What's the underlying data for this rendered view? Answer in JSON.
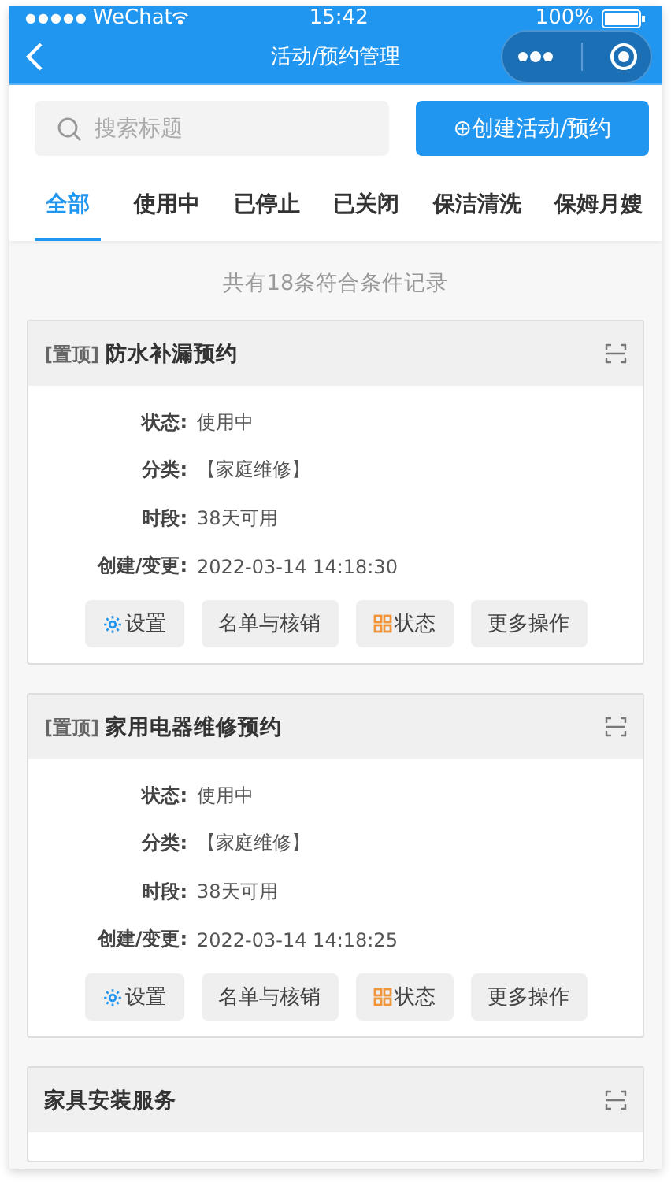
{
  "status_bar": {
    "signal": "●●●●●",
    "carrier": "WeChat",
    "time": "15:42",
    "battery": "100%"
  },
  "nav": {
    "title": "活动/预约管理"
  },
  "search": {
    "placeholder": "搜索标题"
  },
  "create_button": {
    "icon": "⊕",
    "label": "创建活动/预约"
  },
  "tabs": [
    {
      "label": "全部",
      "selected": true
    },
    {
      "label": "使用中",
      "selected": false
    },
    {
      "label": "已停止",
      "selected": false
    },
    {
      "label": "已关闭",
      "selected": false
    },
    {
      "label": "保洁清洗",
      "selected": false
    },
    {
      "label": "保姆月嫂",
      "selected": false
    }
  ],
  "count_text": "共有18条符合条件记录",
  "cards": [
    {
      "tag": "[置顶]",
      "title": "防水补漏预约",
      "fields": [
        {
          "label": "状态:",
          "value": "使用中"
        },
        {
          "label": "分类:",
          "value": "【家庭维修】"
        },
        {
          "label": "时段:",
          "value": "38天可用"
        },
        {
          "label": "创建/变更:",
          "value": "2022-03-14 14:18:30"
        }
      ],
      "actions": [
        {
          "kind": "gear",
          "label": "设置"
        },
        {
          "kind": "plain",
          "label": "名单与核销"
        },
        {
          "kind": "grid",
          "label": "状态"
        },
        {
          "kind": "plain",
          "label": "更多操作"
        }
      ]
    },
    {
      "tag": "[置顶]",
      "title": "家用电器维修预约",
      "fields": [
        {
          "label": "状态:",
          "value": "使用中"
        },
        {
          "label": "分类:",
          "value": "【家庭维修】"
        },
        {
          "label": "时段:",
          "value": "38天可用"
        },
        {
          "label": "创建/变更:",
          "value": "2022-03-14 14:18:25"
        }
      ],
      "actions": [
        {
          "kind": "gear",
          "label": "设置"
        },
        {
          "kind": "plain",
          "label": "名单与核销"
        },
        {
          "kind": "grid",
          "label": "状态"
        },
        {
          "kind": "plain",
          "label": "更多操作"
        }
      ]
    },
    {
      "title": "家具安装服务"
    }
  ]
}
